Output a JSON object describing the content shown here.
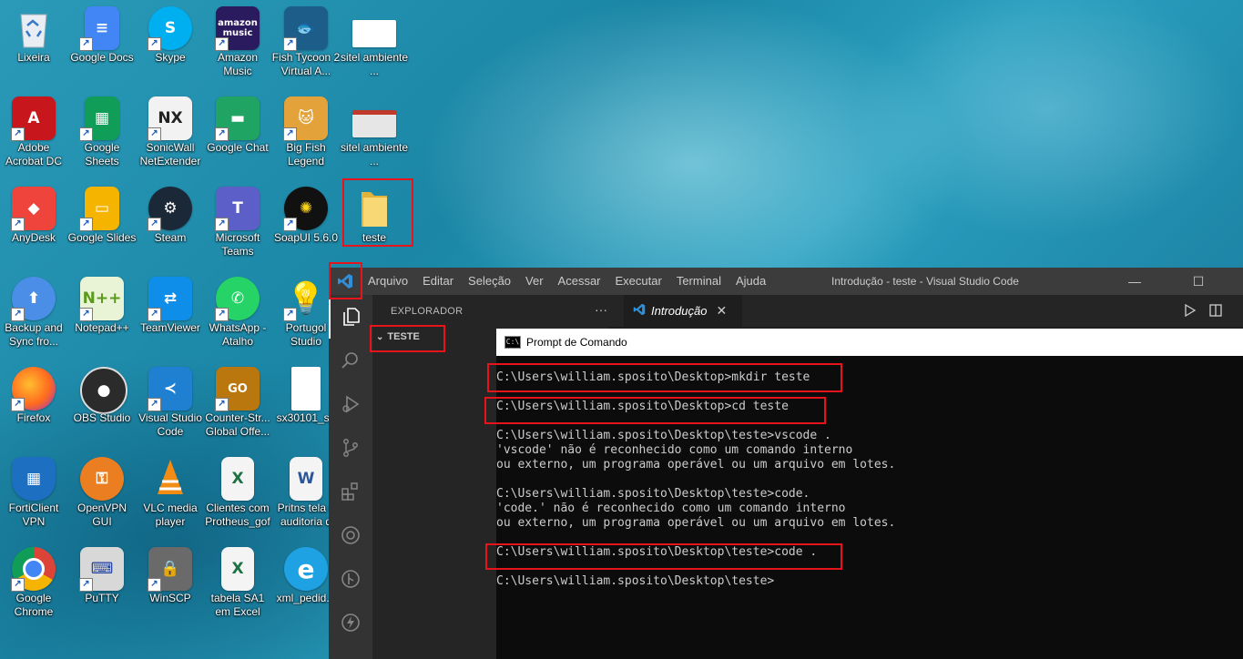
{
  "desktop": {
    "icons": [
      {
        "label": "Lixeira"
      },
      {
        "label": "Google Docs"
      },
      {
        "label": "Skype"
      },
      {
        "label": "Amazon Music"
      },
      {
        "label": "Fish Tycoon 2 Virtual A..."
      },
      {
        "label": "sitel ambiente ..."
      },
      {
        "label": "Adobe Acrobat DC"
      },
      {
        "label": "Google Sheets"
      },
      {
        "label": "SonicWall NetExtender"
      },
      {
        "label": "Google Chat"
      },
      {
        "label": "Big Fish Legend"
      },
      {
        "label": "sitel ambiente ..."
      },
      {
        "label": "AnyDesk"
      },
      {
        "label": "Google Slides"
      },
      {
        "label": "Steam"
      },
      {
        "label": "Microsoft Teams"
      },
      {
        "label": "SoapUI 5.6.0"
      },
      {
        "label": "teste"
      },
      {
        "label": "Backup and Sync fro..."
      },
      {
        "label": "Notepad++"
      },
      {
        "label": "TeamViewer"
      },
      {
        "label": "WhatsApp - Atalho"
      },
      {
        "label": "Portugol Studio"
      },
      {
        "label": "Firefox"
      },
      {
        "label": "OBS Studio"
      },
      {
        "label": "Visual Studio Code"
      },
      {
        "label": "Counter-Str... Global Offe..."
      },
      {
        "label": "sx30101_sa"
      },
      {
        "label": "FortiClient VPN"
      },
      {
        "label": "OpenVPN GUI"
      },
      {
        "label": "VLC media player"
      },
      {
        "label": "Clientes com Protheus_gof"
      },
      {
        "label": "Pritns tela c auditoria d"
      },
      {
        "label": "Google Chrome"
      },
      {
        "label": "PuTTY"
      },
      {
        "label": "WinSCP"
      },
      {
        "label": "tabela SA1 em Excel"
      },
      {
        "label": "xml_pedid..."
      }
    ]
  },
  "vscode": {
    "menu": [
      "Arquivo",
      "Editar",
      "Seleção",
      "Ver",
      "Acessar",
      "Executar",
      "Terminal",
      "Ajuda"
    ],
    "window_title": "Introdução - teste - Visual Studio Code",
    "explorer_title": "EXPLORADOR",
    "explorer_more": "···",
    "folder": "TESTE",
    "tab_label": "Introdução",
    "tab_close": "✕",
    "win_min": "—",
    "win_max": "☐",
    "win_close": "✕"
  },
  "cmd": {
    "title": "Prompt de Comando",
    "icon_text": "C:\\",
    "lines": [
      "C:\\Users\\william.sposito\\Desktop>mkdir teste",
      "C:\\Users\\william.sposito\\Desktop>cd teste",
      "C:\\Users\\william.sposito\\Desktop\\teste>vscode .",
      "'vscode' não é reconhecido como um comando interno",
      "ou externo, um programa operável ou um arquivo em lotes.",
      "C:\\Users\\william.sposito\\Desktop\\teste>code.",
      "'code.' não é reconhecido como um comando interno",
      "ou externo, um programa operável ou um arquivo em lotes.",
      "C:\\Users\\william.sposito\\Desktop\\teste>code .",
      "C:\\Users\\william.sposito\\Desktop\\teste>"
    ]
  },
  "colors": {
    "highlight": "#e8141c",
    "vscode_blue": "#2f8fd8"
  }
}
